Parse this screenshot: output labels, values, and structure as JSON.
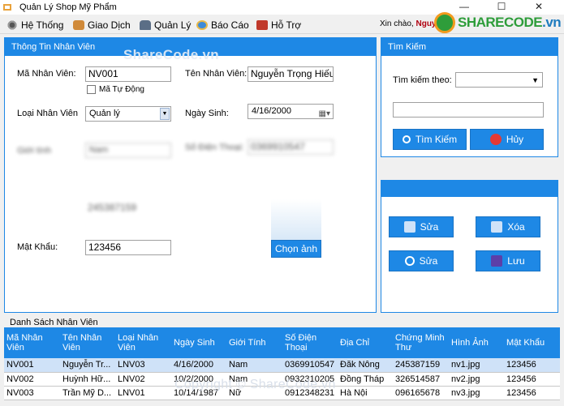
{
  "window": {
    "title": "Quản Lý Shop Mỹ Phẩm",
    "min": "—",
    "max": "☐",
    "close": "✕"
  },
  "menu": [
    {
      "label": "Hệ Thống",
      "icon": "gears-icon"
    },
    {
      "label": "Giao Dịch",
      "icon": "handshake-icon"
    },
    {
      "label": "Quản Lý",
      "icon": "car-icon"
    },
    {
      "label": "Báo Cáo",
      "icon": "globe-icon"
    },
    {
      "label": "Hỗ Trợ",
      "icon": "support-icon"
    }
  ],
  "greeting": {
    "prefix": "Xin chào,",
    "user": "Nguy"
  },
  "watermark": {
    "logo_text": "SHARECODE",
    "logo_domain": ".vn",
    "center": "ShareCode.vn",
    "bottom": "Copyright © ShareCode.vn"
  },
  "info_panel": {
    "title": "Thông Tin Nhân Viên",
    "ma_nv_label": "Mã Nhân Viên:",
    "ma_nv": "NV001",
    "auto_label": "Mã Tự Động",
    "ten_nv_label": "Tên Nhân Viên:",
    "ten_nv": "Nguyễn Trọng Hiếu",
    "loai_nv_label": "Loại Nhân Viên",
    "loai_nv": "Quản lý",
    "ngay_sinh_label": "Ngày Sinh:",
    "ngay_sinh": "4/16/2000",
    "gioi_tinh_label": "Giới tính",
    "gioi_tinh": "Nam",
    "sdt_label": "Số Điện Thoại:",
    "sdt": "0369910547",
    "cmnd_value": "245387159",
    "mat_khau_label": "Mật Khẩu:",
    "mat_khau": "123456",
    "chon_anh_label": "Chọn ảnh"
  },
  "search_panel": {
    "title": "Tìm Kiếm",
    "by_label": "Tìm kiếm theo:",
    "by_value": "",
    "keyword": "",
    "search_label": "Tìm Kiếm",
    "cancel_label": "Hủy"
  },
  "actions": {
    "add_label": "Sửa",
    "delete_label": "Xóa",
    "edit_label": "Sửa",
    "save_label": "Lưu"
  },
  "list": {
    "title": "Danh Sách Nhân Viên",
    "columns": [
      "Mã Nhân Viên",
      "Tên Nhân Viên",
      "Loại Nhân Viên",
      "Ngày Sinh",
      "Giới Tính",
      "Số Điện Thoại",
      "Địa Chỉ",
      "Chứng Minh Thư",
      "Hình Ảnh",
      "Mật Khẩu"
    ],
    "rows": [
      [
        "NV001",
        "Nguyễn Tr...",
        "LNV03",
        "4/16/2000",
        "Nam",
        "0369910547",
        "Đăk Nông",
        "245387159",
        "nv1.jpg",
        "123456"
      ],
      [
        "NV002",
        "Huỳnh Hữ...",
        "LNV02",
        "10/2/2000",
        "Nam",
        "0932310205",
        "Đồng Tháp",
        "326514587",
        "nv2.jpg",
        "123456"
      ],
      [
        "NV003",
        "Trần Mỹ D...",
        "LNV01",
        "10/14/1987",
        "Nữ",
        "0912348231",
        "Hà Nội",
        "096165678",
        "nv3.jpg",
        "123456"
      ]
    ]
  },
  "colors": {
    "accent": "#1e88e5",
    "selected_row": "#cfe2f8",
    "greeting_user": "#b00010"
  }
}
